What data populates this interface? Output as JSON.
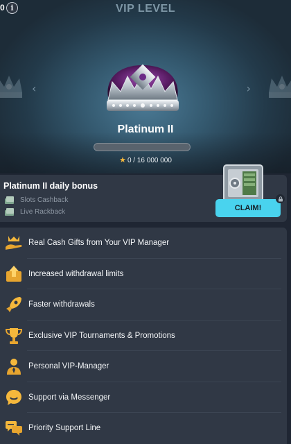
{
  "header": {
    "counter": "0",
    "title": "VIP LEVEL"
  },
  "level": {
    "name": "Platinum II",
    "points": "0 / 16 000 000",
    "progress": 0
  },
  "bonus": {
    "title": "Platinum II daily bonus",
    "items": [
      "Slots Cashback",
      "Live Rackback"
    ],
    "claim_label": "CLAIM!"
  },
  "benefits": [
    "Real Cash Gifts from Your VIP Manager",
    "Increased withdrawal limits",
    "Faster withdrawals",
    "Exclusive VIP Tournaments & Promotions",
    "Personal VIP-Manager",
    "Support via Messenger",
    "Priority Support Line"
  ],
  "colors": {
    "accent": "#49d3ee",
    "gold": "#f4b73a",
    "panel": "#303845",
    "crown_velvet": "#5b1e66"
  },
  "icons": {
    "info": "info-icon",
    "crown": "crown-icon",
    "safe": "safe-icon",
    "lock": "lock-icon"
  }
}
